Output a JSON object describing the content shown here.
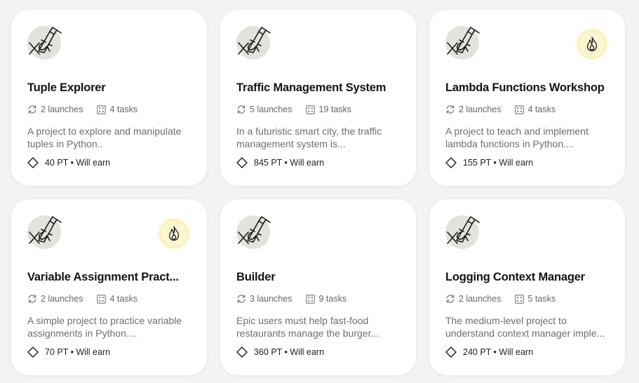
{
  "projects": [
    {
      "title": "Tuple Explorer",
      "launches": "2 launches",
      "tasks": "4 tasks",
      "description": "A project to explore and manipulate tuples in Python..",
      "points": "40 PT • Will earn",
      "hot": false
    },
    {
      "title": "Traffic Management System",
      "launches": "5 launches",
      "tasks": "19 tasks",
      "description": "In a futuristic smart city, the traffic management system is...",
      "points": "845 PT • Will earn",
      "hot": false
    },
    {
      "title": "Lambda Functions Workshop",
      "launches": "2 launches",
      "tasks": "4 tasks",
      "description": "A project to teach and implement lambda functions in Python....",
      "points": "155 PT • Will earn",
      "hot": true
    },
    {
      "title": "Variable Assignment Pract...",
      "launches": "2 launches",
      "tasks": "4 tasks",
      "description": "A simple project to practice variable assignments in Python....",
      "points": "70 PT • Will earn",
      "hot": true
    },
    {
      "title": "Builder",
      "launches": "3 launches",
      "tasks": "9 tasks",
      "description": "Epic users must help fast-food restaurants manage the burger...",
      "points": "360 PT • Will earn",
      "hot": false
    },
    {
      "title": "Logging Context Manager",
      "launches": "2 launches",
      "tasks": "5 tasks",
      "description": "The medium-level project to understand context manager imple...",
      "points": "240 PT • Will earn",
      "hot": false
    }
  ],
  "colors": {
    "card": "#ffffff",
    "logo_bg": "#e4e2dc",
    "hot_bg": "#fbf6d0",
    "title": "#141414",
    "muted": "#666666"
  }
}
